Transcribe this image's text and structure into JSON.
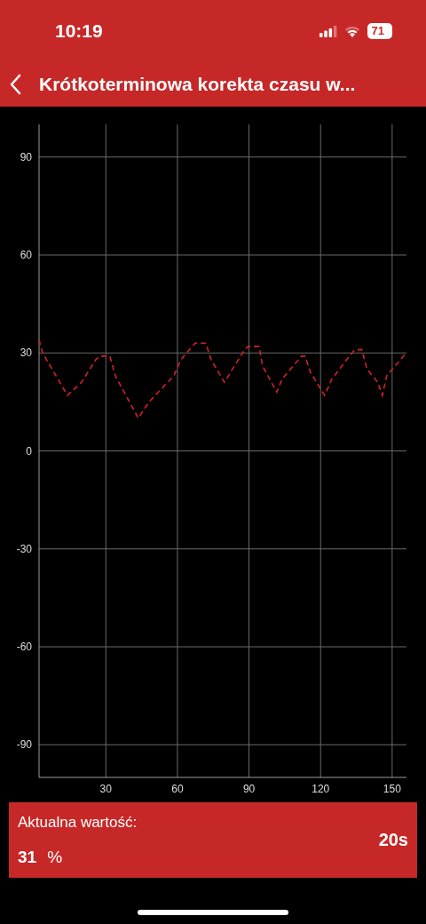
{
  "status_bar": {
    "time": "10:19",
    "battery": "71"
  },
  "header": {
    "title": "Krótkoterminowa korekta czasu w..."
  },
  "chart": {
    "chart_data": {
      "type": "line",
      "x": [
        2,
        3.5,
        13.9,
        19.8,
        25.8,
        27.7,
        31.7,
        34,
        43.6,
        48.1,
        58.5,
        61.5,
        67.4,
        71.9,
        74.1,
        79.7,
        83,
        88.2,
        89.7,
        94.2,
        95.7,
        101.6,
        103.9,
        112,
        113.5,
        115.8,
        121.7,
        124.7,
        132.1,
        134.3,
        137.3,
        139.5,
        144,
        145.9,
        147.7,
        155.9
      ],
      "grid": true,
      "series": [
        {
          "color": "#d32027",
          "line_style": "dashed",
          "values": [
            34,
            30,
            17,
            21,
            28,
            29,
            29,
            23,
            10,
            15,
            23,
            28,
            33,
            33,
            28,
            21,
            25,
            31,
            32,
            32,
            26,
            18,
            22,
            29,
            29,
            24,
            17,
            22,
            29,
            31,
            31,
            25,
            21,
            17,
            23,
            30
          ]
        }
      ],
      "xlim": [
        2,
        156
      ],
      "ylim": [
        -100,
        100
      ],
      "xticks": [
        30,
        60,
        90,
        120,
        150
      ],
      "yticks": [
        -90,
        -60,
        -30,
        0,
        30,
        60,
        90
      ]
    }
  },
  "current_value": {
    "label": "Aktualna wartość:",
    "value": "31",
    "unit": "%",
    "interval": "20s"
  }
}
